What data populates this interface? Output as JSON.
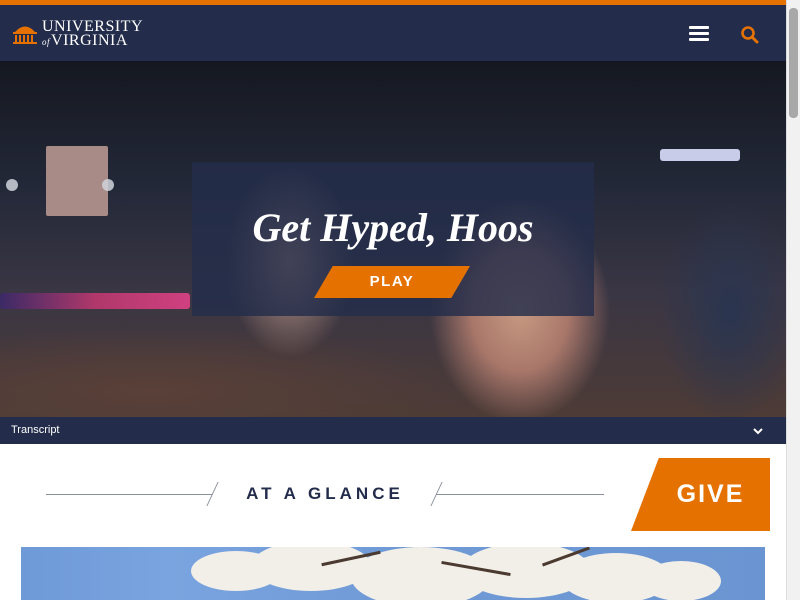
{
  "brand": {
    "name_line1": "UNIVERSITY",
    "name_of": "of",
    "name_line2": "VIRGINIA",
    "primary_color": "#232d4b",
    "accent_color": "#e57200"
  },
  "header": {
    "menu_icon": "hamburger-menu-icon",
    "search_icon": "search-icon"
  },
  "hero": {
    "title": "Get Hyped, Hoos",
    "play_label": "PLAY"
  },
  "transcript": {
    "label": "Transcript",
    "chevron_icon": "chevron-down-icon"
  },
  "glance": {
    "title": "AT A GLANCE",
    "give_label": "GIVE"
  }
}
